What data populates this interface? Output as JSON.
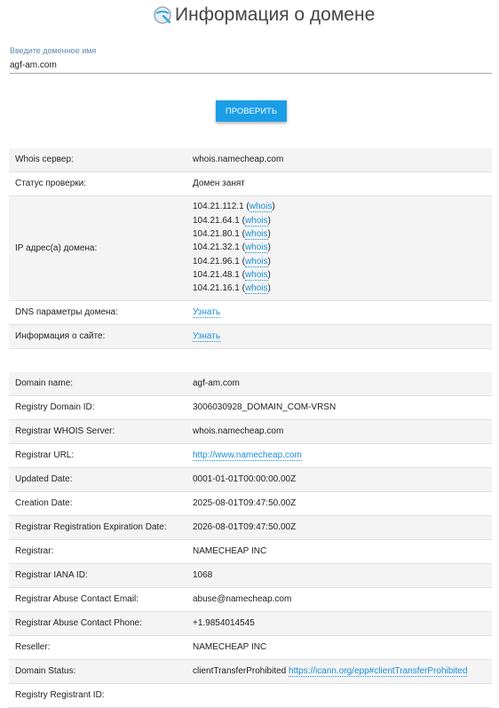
{
  "header": {
    "title": "Информация о домене",
    "icon": "magnifier-globe-icon"
  },
  "form": {
    "label": "Введите доменное имя",
    "value": "agf-am.com",
    "button_label": "ПРОВЕРИТЬ"
  },
  "summary": {
    "whois_server_label": "Whois сервер:",
    "whois_server_value": "whois.namecheap.com",
    "status_label": "Статус проверки:",
    "status_value": "Домен занят",
    "ip_label": "IP адрес(а) домена:",
    "ips": [
      {
        "ip": "104.21.112.1",
        "link": "whois"
      },
      {
        "ip": "104.21.64.1",
        "link": "whois"
      },
      {
        "ip": "104.21.80.1",
        "link": "whois"
      },
      {
        "ip": "104.21.32.1",
        "link": "whois"
      },
      {
        "ip": "104.21.96.1",
        "link": "whois"
      },
      {
        "ip": "104.21.48.1",
        "link": "whois"
      },
      {
        "ip": "104.21.16.1",
        "link": "whois"
      }
    ],
    "dns_label": "DNS параметры домена:",
    "dns_link": "Узнать",
    "site_label": "Информация о сайте:",
    "site_link": "Узнать"
  },
  "whois": {
    "rows": [
      {
        "label": "Domain name:",
        "value": "agf-am.com"
      },
      {
        "label": "Registry Domain ID:",
        "value": "3006030928_DOMAIN_COM-VRSN"
      },
      {
        "label": "Registrar WHOIS Server:",
        "value": "whois.namecheap.com"
      },
      {
        "label": "Registrar URL:",
        "value": "",
        "link": "http://www.namecheap.com"
      },
      {
        "label": "Updated Date:",
        "value": "0001-01-01T00:00:00.00Z"
      },
      {
        "label": "Creation Date:",
        "value": "2025-08-01T09:47:50.00Z"
      },
      {
        "label": "Registrar Registration Expiration Date:",
        "value": "2026-08-01T09:47:50.00Z"
      },
      {
        "label": "Registrar:",
        "value": "NAMECHEAP INC"
      },
      {
        "label": "Registrar IANA ID:",
        "value": "1068"
      },
      {
        "label": "Registrar Abuse Contact Email:",
        "value": "abuse@namecheap.com"
      },
      {
        "label": "Registrar Abuse Contact Phone:",
        "value": "+1.9854014545"
      },
      {
        "label": "Reseller:",
        "value": "NAMECHEAP INC"
      },
      {
        "label": "Domain Status:",
        "value": "clientTransferProhibited ",
        "link": "https://icann.org/epp#clientTransferProhibited"
      },
      {
        "label": "Registry Registrant ID:",
        "value": ""
      }
    ]
  }
}
